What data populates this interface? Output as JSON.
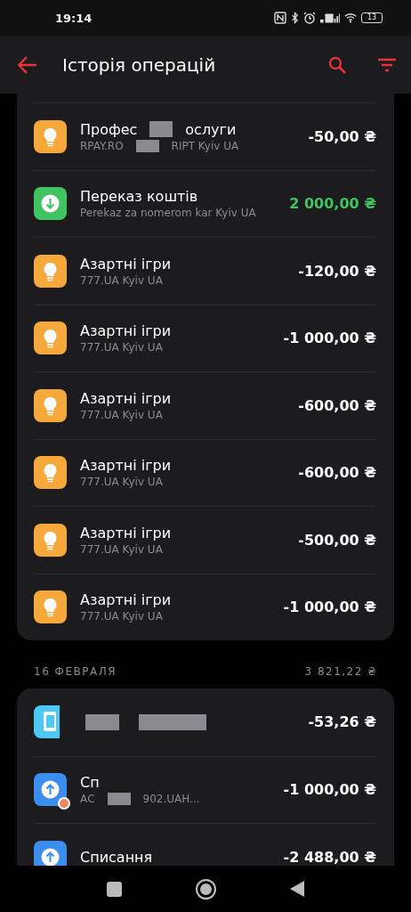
{
  "status_bar": {
    "time": "19:14",
    "battery": "13"
  },
  "header": {
    "title": "Історія операцій"
  },
  "groups": [
    {
      "items": [
        {
          "kind": "purchase",
          "title": [
            "Профес",
            "ослуги"
          ],
          "subtitle": [
            "RPAY.RO",
            "RIPT Kyiv UA"
          ],
          "amount": "-50,00 ₴"
        },
        {
          "kind": "incoming",
          "title": [
            "Переказ коштів"
          ],
          "subtitle": [
            "Perekaz za nomerom kar Kyiv UA"
          ],
          "amount": "2 000,00 ₴"
        },
        {
          "kind": "purchase",
          "title": [
            "Азартні ігри"
          ],
          "subtitle": [
            "777.UA Kyiv UA"
          ],
          "amount": "-120,00 ₴"
        },
        {
          "kind": "purchase",
          "title": [
            "Азартні ігри"
          ],
          "subtitle": [
            "777.UA Kyiv UA"
          ],
          "amount": "-1 000,00 ₴"
        },
        {
          "kind": "purchase",
          "title": [
            "Азартні ігри"
          ],
          "subtitle": [
            "777.UA Kyiv UA"
          ],
          "amount": "-600,00 ₴"
        },
        {
          "kind": "purchase",
          "title": [
            "Азартні ігри"
          ],
          "subtitle": [
            "777.UA Kyiv UA"
          ],
          "amount": "-600,00 ₴"
        },
        {
          "kind": "purchase",
          "title": [
            "Азартні ігри"
          ],
          "subtitle": [
            "777.UA Kyiv UA"
          ],
          "amount": "-500,00 ₴"
        },
        {
          "kind": "purchase",
          "title": [
            "Азартні ігри"
          ],
          "subtitle": [
            "777.UA Kyiv UA"
          ],
          "amount": "-1 000,00 ₴"
        }
      ]
    },
    {
      "date": "16 ФЕВРАЛЯ",
      "total": "3 821,22 ₴",
      "items": [
        {
          "kind": "app",
          "amount": "-53,26 ₴"
        },
        {
          "kind": "outgoing",
          "pending": true,
          "title": [
            "Сп"
          ],
          "subtitle": [
            "АС",
            "902.UAH..."
          ],
          "amount": "-1 000,00 ₴"
        },
        {
          "kind": "outgoing",
          "title": [
            "Списання"
          ],
          "amount": "-2 488,00 ₴"
        }
      ]
    }
  ]
}
